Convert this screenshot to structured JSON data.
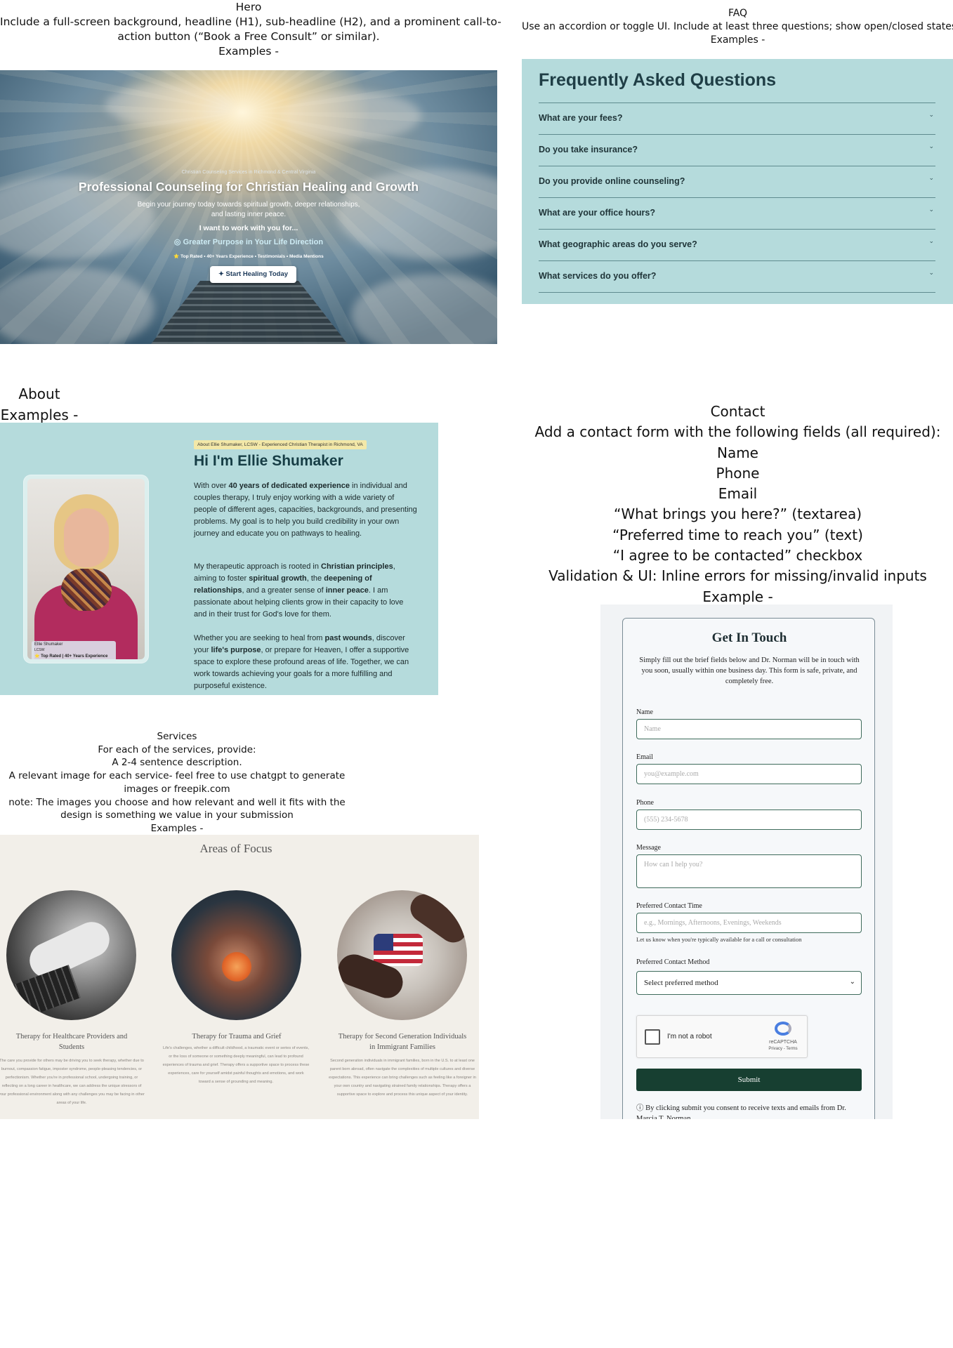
{
  "hero_caption": {
    "title": "Hero",
    "lines": [
      "Include a full-screen background, headline (H1), sub-headline (H2), and a prominent call-to-",
      "action button (“Book a Free Consult” or similar).",
      "Examples -"
    ]
  },
  "hero": {
    "kicker": "Christian Counseling Services in Richmond & Central Virginia",
    "h1": "Professional Counseling for Christian Healing and Growth",
    "sub_line1": "Begin your journey today towards spiritual growth, deeper relationships,",
    "sub_line2": "and lasting inner peace.",
    "want": "I want to work with you for...",
    "rotating": "Greater Purpose in Your Life Direction",
    "rotating_icon": "check-circle-icon",
    "trust_line": "⭐ Top Rated • 40+ Years Experience • Testimonials • Media Mentions",
    "cta": "Start Healing Today",
    "cta_icon": "sparkle-icon"
  },
  "faq_caption": {
    "title": "FAQ",
    "lines": [
      "Use an accordion or toggle UI. Include at least three questions; show open/closed states.",
      "Examples -"
    ]
  },
  "faq": {
    "title": "Frequently Asked Questions",
    "chevron": "⌄",
    "items": [
      {
        "q": "What are your fees?"
      },
      {
        "q": "Do you take insurance?"
      },
      {
        "q": "Do you provide online counseling?"
      },
      {
        "q": "What are your office hours?"
      },
      {
        "q": "What geographic areas do you serve?"
      },
      {
        "q": "What services do you offer?"
      }
    ]
  },
  "about_caption": {
    "title": "About",
    "examples": "Examples -"
  },
  "about": {
    "badge": "About Ellie Shumaker, LCSW - Experienced Christian Therapist in Richmond, VA",
    "heading": "Hi I'm Ellie Shumaker",
    "photo_tag_name": "Ellie Shumaker",
    "photo_tag_cred": "LCSW",
    "photo_tag_meta": "⭐ Top Rated | 40+ Years Experience",
    "p1": [
      "With over ",
      "40 years of dedicated experience",
      " in individual and couples therapy, I truly enjoy working with a wide variety of people of different ages, capacities, backgrounds, and presenting problems. My goal is to help you build credibility in your own journey and educate you on pathways to healing."
    ],
    "p2": [
      "My therapeutic approach is rooted in ",
      "Christian principles",
      ", aiming to foster ",
      "spiritual growth",
      ", the ",
      "deepening of relationships",
      ", and a greater sense of ",
      "inner peace",
      ". I am passionate about helping clients grow in their capacity to love and in their trust for God's love for them."
    ],
    "p3": [
      "Whether you are seeking to heal from ",
      "past wounds",
      ", discover your ",
      "life's purpose",
      ", or prepare for Heaven, I offer a supportive space to explore these profound areas of life. Together, we can work towards achieving your goals for a more fulfilling and purposeful existence."
    ]
  },
  "contact_caption": {
    "title": "Contact",
    "lines": [
      "Add a contact form with the following fields (all required):",
      "Name",
      "Phone",
      "Email",
      "“What brings you here?” (textarea)",
      "“Preferred time to reach you” (text)",
      "“I agree to be contacted” checkbox",
      "Validation & UI: Inline errors for missing/invalid inputs",
      "Example -"
    ]
  },
  "contact": {
    "title": "Get In Touch",
    "intro": "Simply fill out the brief fields below and Dr. Norman will be in touch with you soon, usually within one business day. This form is safe, private, and completely free.",
    "name_label": "Name",
    "name_ph": "Name",
    "email_label": "Email",
    "email_ph": "you@example.com",
    "phone_label": "Phone",
    "phone_ph": "(555) 234-5678",
    "message_label": "Message",
    "message_ph": "How can I help you?",
    "time_label": "Preferred Contact Time",
    "time_ph": "e.g., Mornings, Afternoons, Evenings, Weekends",
    "time_hint": "Let us know when you're typically available for a call or consultation",
    "method_label": "Preferred Contact Method",
    "method_value": "Select preferred method",
    "captcha_label": "I'm not a robot",
    "captcha_brand": "reCAPTCHA",
    "captcha_links": "Privacy - Terms",
    "submit": "Submit",
    "consent": "ⓘ By clicking submit you consent to receive texts and emails from Dr. Marcia T. Norman"
  },
  "services_caption": {
    "title": "Services",
    "lines": [
      "For each of the services, provide:",
      "A 2-4 sentence description.",
      "A relevant image for each service- feel free to use chatgpt to generate",
      "images or freepik.com",
      "note: The images you choose and how relevant and well it fits with the",
      "design is something we value in your submission",
      "Examples -"
    ]
  },
  "services": {
    "title": "Areas of Focus",
    "items": [
      {
        "name1": "Therapy for Healthcare Providers and",
        "name2": "Students",
        "desc": "The care you provide for others may be driving you to seek therapy, whether due to burnout, compassion fatigue, imposter syndrome, people-pleasing tendencies, or perfectionism. Whether you're in professional school, undergoing training, or reflecting on a long career in healthcare, we can address the unique stressors of your professional environment along with any challenges you may be facing in other areas of your life."
      },
      {
        "name1": "Therapy for Trauma and Grief",
        "name2": "",
        "desc": "Life's challenges, whether a difficult childhood, a traumatic event or series of events, or the loss of someone or something deeply meaningful, can lead to profound experiences of trauma and grief. Therapy offers a supportive space to process these experiences, care for yourself amidst painful thoughts and emotions, and work toward a sense of grounding and meaning."
      },
      {
        "name1": "Therapy for Second Generation Individuals",
        "name2": "in Immigrant Families",
        "desc": "Second generation individuals in immigrant families, born in the U.S. to at least one parent born abroad, often navigate the complexities of multiple cultures and diverse expectations. This experience can bring challenges such as feeling like a foreigner in your own country and navigating strained family relationships. Therapy offers a supportive space to explore and process this unique aspect of your identity."
      }
    ]
  },
  "colors": {
    "teal_panel": "#b5dbdc",
    "beige_panel": "#f2efe9",
    "submit_green": "#173f31"
  }
}
